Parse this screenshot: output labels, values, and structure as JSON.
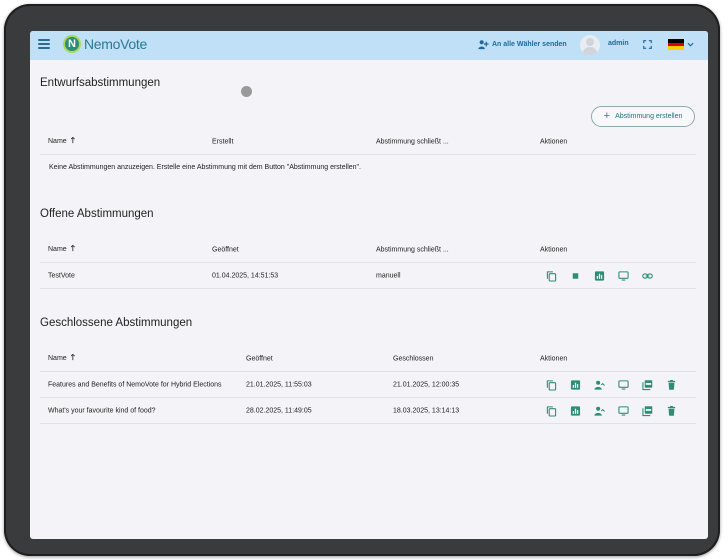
{
  "header": {
    "logo_text": "NemoVote",
    "logo_mark": "N",
    "send_all_label": "An alle Wähler senden",
    "user_name": "admin",
    "language_flag": "de"
  },
  "colors": {
    "topbar": "#bfe0f6",
    "accent": "#2e8d76",
    "link": "#1f6a9c"
  },
  "drafts": {
    "title": "Entwurfsabstimmungen",
    "create_button": "Abstimmung erstellen",
    "columns": [
      "Name",
      "Erstellt",
      "Abstimmung schließt ...",
      "Aktionen"
    ],
    "empty_message": "Keine Abstimmungen anzuzeigen. Erstelle eine Abstimmung mit dem Button \"Abstimmung erstellen\"."
  },
  "open": {
    "title": "Offene Abstimmungen",
    "columns": [
      "Name",
      "Geöffnet",
      "Abstimmung schließt ...",
      "Aktionen"
    ],
    "rows": [
      {
        "name": "TestVote",
        "opened": "01.04.2025, 14:51:53",
        "closes": "manuell",
        "actions": [
          "copy-icon",
          "stop-icon",
          "results-icon",
          "presentation-icon",
          "link-icon"
        ]
      }
    ]
  },
  "closed": {
    "title": "Geschlossene Abstimmungen",
    "columns": [
      "Name",
      "Geöffnet",
      "Geschlossen",
      "Aktionen"
    ],
    "rows": [
      {
        "name": "Features and Benefits of NemoVote for Hybrid Elections",
        "opened": "21.01.2025, 11:55:03",
        "closed": "21.01.2025, 12:00:35",
        "actions": [
          "copy-icon",
          "results-icon",
          "voters-icon",
          "presentation-icon",
          "pdf-icon",
          "delete-icon"
        ]
      },
      {
        "name": "What's your favourite kind of food?",
        "opened": "28.02.2025, 11:49:05",
        "closed": "18.03.2025, 13:14:13",
        "actions": [
          "copy-icon",
          "results-icon",
          "voters-icon",
          "presentation-icon",
          "pdf-icon",
          "delete-icon"
        ]
      }
    ]
  }
}
